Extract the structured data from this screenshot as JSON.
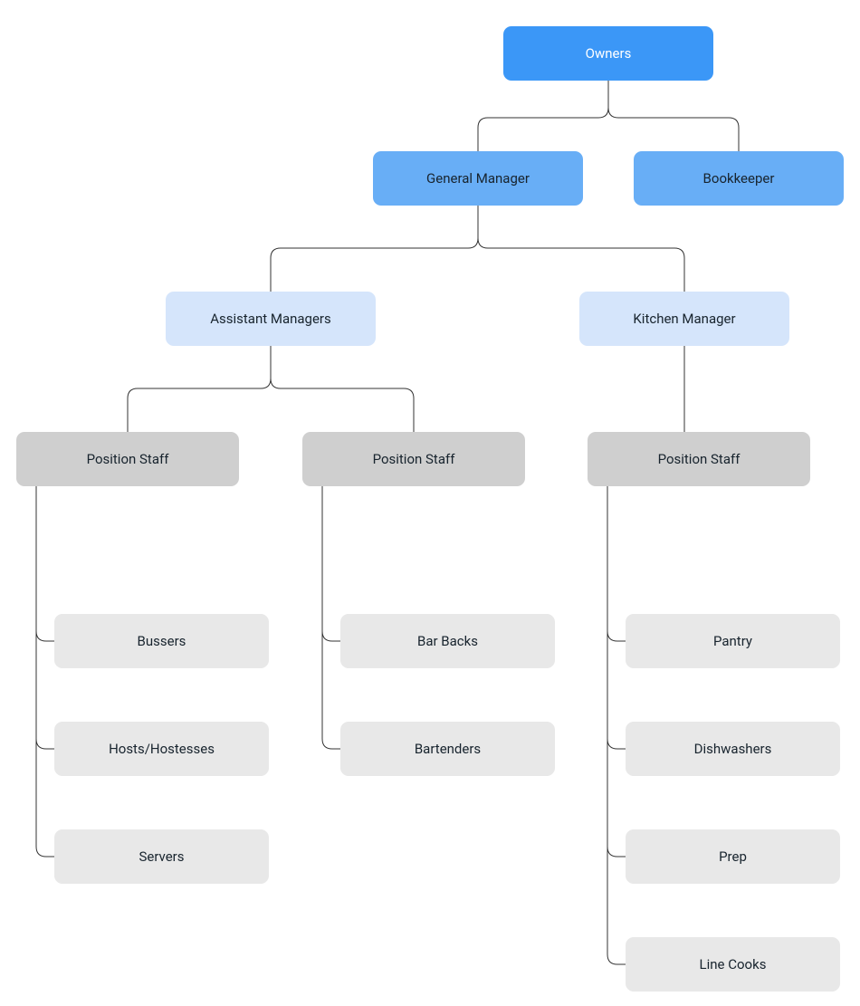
{
  "chart_data": {
    "type": "org-chart",
    "nodes": [
      {
        "id": "owners",
        "label": "Owners",
        "level": 0,
        "parent": null
      },
      {
        "id": "general_manager",
        "label": "General Manager",
        "level": 1,
        "parent": "owners"
      },
      {
        "id": "bookkeeper",
        "label": "Bookkeeper",
        "level": 1,
        "parent": "owners"
      },
      {
        "id": "assistant_managers",
        "label": "Assistant Managers",
        "level": 2,
        "parent": "general_manager"
      },
      {
        "id": "kitchen_manager",
        "label": "Kitchen Manager",
        "level": 2,
        "parent": "general_manager"
      },
      {
        "id": "pos_staff_am1",
        "label": "Position Staff",
        "level": 3,
        "parent": "assistant_managers"
      },
      {
        "id": "pos_staff_am2",
        "label": "Position Staff",
        "level": 3,
        "parent": "assistant_managers"
      },
      {
        "id": "pos_staff_km",
        "label": "Position Staff",
        "level": 3,
        "parent": "kitchen_manager"
      },
      {
        "id": "bussers",
        "label": "Bussers",
        "level": 4,
        "parent": "pos_staff_am1"
      },
      {
        "id": "hosts",
        "label": "Hosts/Hostesses",
        "level": 4,
        "parent": "pos_staff_am1"
      },
      {
        "id": "servers",
        "label": "Servers",
        "level": 4,
        "parent": "pos_staff_am1"
      },
      {
        "id": "bar_backs",
        "label": "Bar Backs",
        "level": 4,
        "parent": "pos_staff_am2"
      },
      {
        "id": "bartenders",
        "label": "Bartenders",
        "level": 4,
        "parent": "pos_staff_am2"
      },
      {
        "id": "pantry",
        "label": "Pantry",
        "level": 4,
        "parent": "pos_staff_km"
      },
      {
        "id": "dishwashers",
        "label": "Dishwashers",
        "level": 4,
        "parent": "pos_staff_km"
      },
      {
        "id": "prep",
        "label": "Prep",
        "level": 4,
        "parent": "pos_staff_km"
      },
      {
        "id": "line_cooks",
        "label": "Line Cooks",
        "level": 4,
        "parent": "pos_staff_km"
      }
    ]
  },
  "colors": {
    "level0": "#3b97f7",
    "level1": "#68aef6",
    "level2": "#d5e5fb",
    "level3": "#cfcfcf",
    "level4": "#e8e8e8",
    "connector": "#333333"
  }
}
